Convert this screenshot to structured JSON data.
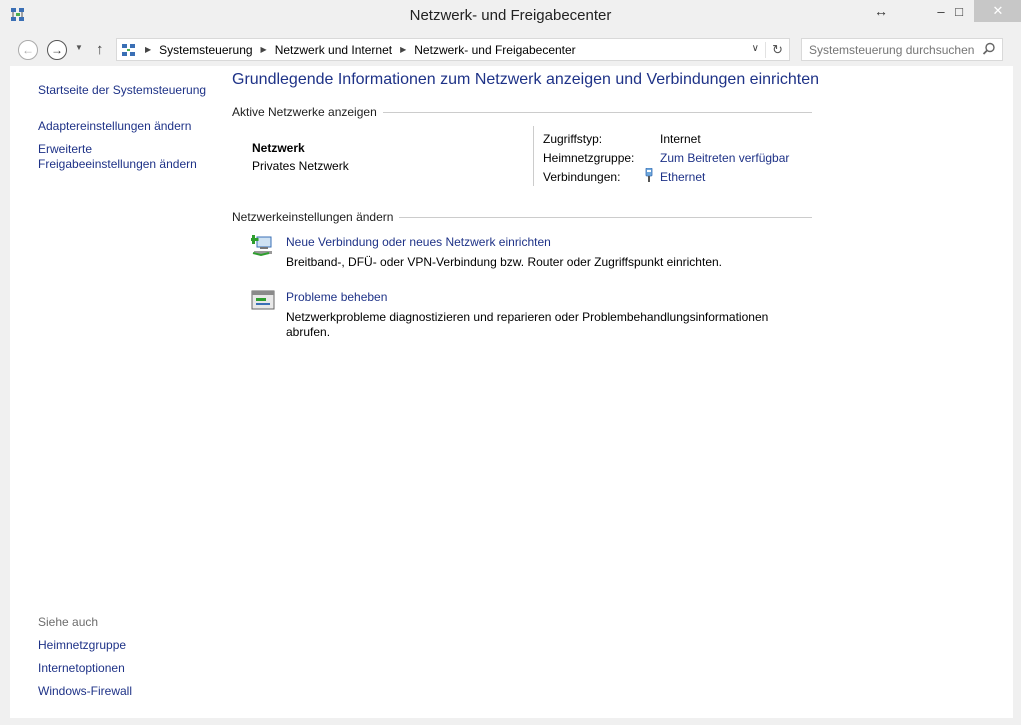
{
  "window": {
    "title": "Netzwerk- und Freigabecenter",
    "resize_glyph": "↔",
    "min_glyph": "–",
    "max_glyph": "□",
    "close_glyph": "✕"
  },
  "nav": {
    "back_glyph": "←",
    "forward_glyph": "→",
    "recent_glyph": "▼",
    "up_glyph": "↑",
    "breadcrumb": [
      "Systemsteuerung",
      "Netzwerk und Internet",
      "Netzwerk- und Freigabecenter"
    ],
    "sep_glyph": "▶",
    "dropdown_glyph": "∨",
    "refresh_glyph": "↻",
    "search_placeholder": "Systemsteuerung durchsuchen"
  },
  "sidebar": {
    "links": [
      "Startseite der Systemsteuerung",
      "Adaptereinstellungen ändern",
      "Erweiterte",
      "Freigabeeinstellungen ändern"
    ],
    "see_also_title": "Siehe auch",
    "see_also": [
      "Heimnetzgruppe",
      "Internetoptionen",
      "Windows-Firewall"
    ]
  },
  "main": {
    "heading": "Grundlegende Informationen zum Netzwerk anzeigen und Verbindungen einrichten",
    "active_section": "Aktive Netzwerke anzeigen",
    "network": {
      "name": "Netzwerk",
      "type": "Privates Netzwerk",
      "access_label": "Zugriffstyp:",
      "access_value": "Internet",
      "homegroup_label": "Heimnetzgruppe:",
      "homegroup_value": "Zum Beitreten verfügbar",
      "connections_label": "Verbindungen:",
      "connections_value": "Ethernet"
    },
    "settings_section": "Netzwerkeinstellungen ändern",
    "tasks": [
      {
        "title": "Neue Verbindung oder neues Netzwerk einrichten",
        "desc": "Breitband-, DFÜ- oder VPN-Verbindung bzw. Router oder Zugriffspunkt einrichten."
      },
      {
        "title": "Probleme beheben",
        "desc": "Netzwerkprobleme diagnostizieren und reparieren oder Problembehandlungsinformationen abrufen."
      }
    ]
  },
  "colors": {
    "link": "#1e3287",
    "close_button": "#c7c7c7",
    "window_bg": "#f0f0f0"
  }
}
